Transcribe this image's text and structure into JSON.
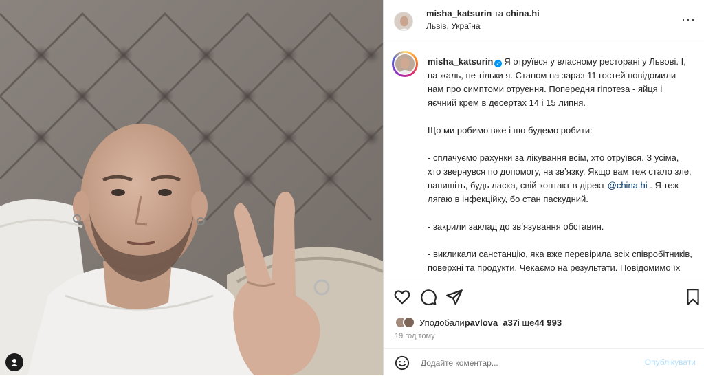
{
  "post": {
    "photo_alt": "",
    "tagged_icon": "person-tag-icon"
  },
  "header": {
    "author": "misha_katsurin",
    "joiner": "та",
    "coauthor": "china.hi",
    "location": "Львів, Україна",
    "more_icon": "more-horizontal-icon",
    "more_label": "···"
  },
  "caption": {
    "username": "misha_katsurin",
    "p1": "Я отруївся у власному ресторані у Львові. І, на жаль, не тільки я. Станом на зараз 11 гостей повідомили нам про симптоми отруєння. Попередня гіпотеза - яйця і яєчний крем в десертах 14 і 15 липня.",
    "p2": "Що ми робимо вже і що будемо робити:",
    "p3_before": "- сплачуємо рахунки за лікування всім, хто отруївся. З усіма, хто звернувся по допомогу, на зв’язку. Якщо вам теж стало зле, напишіть, будь ласка, свій контакт в дірект ",
    "p3_mention": "@china.hi",
    "p3_after": " . Я теж лягаю в інфекційку, бо стан паскудний.",
    "p4": "- закрили заклад до зв’язування обставин.",
    "p5": "- викликали санстанцію, яка вже перевірила всіх співробітників, поверхні та продукти. Чекаємо на результати. Повідомимо їх кожному постраждалому і громаді також. Всі інші належні законом перевірки звісно пройдемо теж."
  },
  "actions": {
    "like_icon": "heart-icon",
    "comment_icon": "comment-icon",
    "share_icon": "send-icon",
    "save_icon": "bookmark-icon"
  },
  "likes": {
    "prefix": "Уподобали ",
    "first_user": "pavlova_a37",
    "middle": " і ще ",
    "count": "44 993"
  },
  "timestamp": "19 год тому",
  "comment": {
    "placeholder": "Додайте коментар...",
    "publish": "Опублікувати",
    "emoji_icon": "emoji-smile-icon"
  }
}
